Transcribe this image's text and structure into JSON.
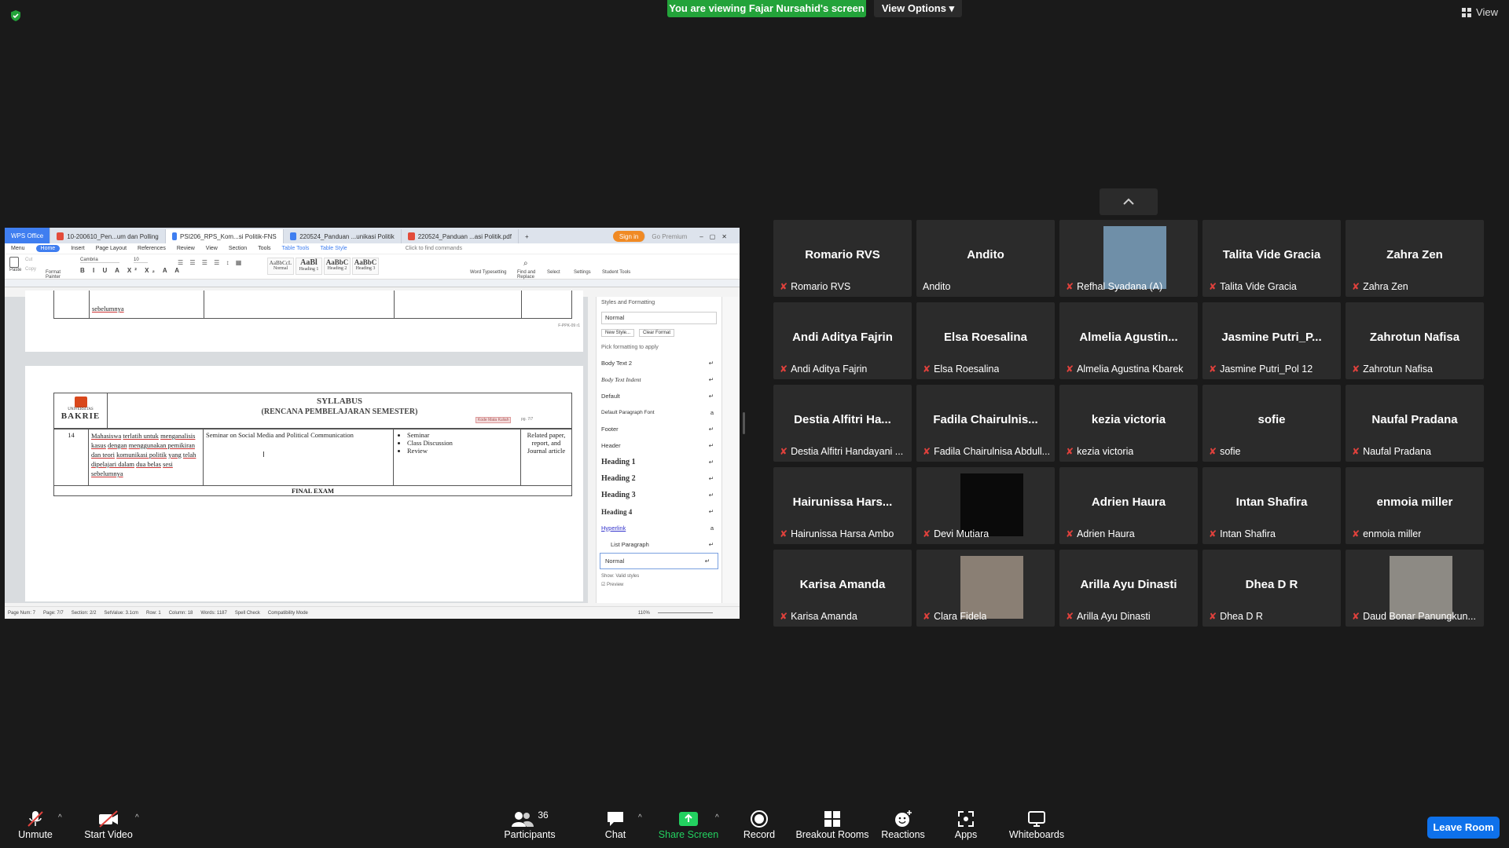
{
  "banner": {
    "viewing": "You are viewing Fajar Nursahid's screen",
    "view_options": "View Options",
    "view": "View"
  },
  "shared": {
    "tabs": [
      "WPS Office",
      "10-200610_Pen...um dan Polling",
      "PSI206_RPS_Kom...si Politik-FNS",
      "220524_Panduan ...unikasi Politik",
      "220524_Panduan ...asi Politik.pdf"
    ],
    "sign_in": "Sign in",
    "go_premium": "Go Premium",
    "menu": [
      "Menu",
      "Home",
      "Insert",
      "Page Layout",
      "References",
      "Review",
      "View",
      "Section",
      "Tools",
      "Table Tools",
      "Table Style"
    ],
    "search": "Click to find commands",
    "ribbon": {
      "paste": "Paste",
      "cut": "Cut",
      "copy": "Copy",
      "format_painter": "Format Painter",
      "font": "Cambria",
      "size": "10",
      "styles": [
        "Normal",
        "Heading 1",
        "Heading 2",
        "Heading 3"
      ],
      "style_previews": [
        "AaBbCcL",
        "AaBl",
        "AaBbC",
        "AaBbC"
      ],
      "word_typesetting": "Word Typesetting",
      "find_replace": "Find and Replace",
      "select": "Select",
      "settings": "Settings",
      "student_tools": "Student Tools"
    },
    "doc": {
      "prev_text": "sebelumnya",
      "footer_code": "F-PPK-09 r1",
      "logo_top": "UNIVERSITAS",
      "logo_name": "BAKRIE",
      "title": "SYLLABUS",
      "subtitle": "(RENCANA PEMBELAJARAN SEMESTER)",
      "kode": "Kode Mata Kuliah",
      "pg": "pg. 7/7",
      "week": "14",
      "competency": [
        "Mahasiswa",
        "terlatih untuk",
        "menganalisis kasus",
        "dengan",
        "menggunakan pemikiran",
        "dan teori",
        "komunikasi politik",
        "yang",
        "telah",
        "dipelajari dalam",
        "dua belas",
        "sesi",
        "sebelumnya"
      ],
      "topic": "Seminar on Social Media and Political Communication",
      "methods": [
        "Seminar",
        "Class Discussion",
        "Review"
      ],
      "assessment": "Related paper, report, and Journal article",
      "final": "FINAL EXAM"
    },
    "pane": {
      "title": "Styles and Formatting",
      "current": "Normal",
      "new_style": "New Style...",
      "clear": "Clear Format",
      "pick": "Pick formatting to apply",
      "styles": [
        "Body Text 2",
        "Body Text Indent",
        "Default",
        "Default Paragraph Font",
        "Footer",
        "Header",
        "Heading 1",
        "Heading 2",
        "Heading 3",
        "Heading 4",
        "Hyperlink",
        "List Paragraph",
        "Normal"
      ],
      "show": "Show:",
      "show_val": "Valid styles",
      "preview": "Preview"
    },
    "status": {
      "page_num": "Page Num: 7",
      "page": "Page: 7/7",
      "section": "Section: 2/2",
      "setvalue": "SetValue: 3.1cm",
      "row": "Row: 1",
      "column": "Column: 18",
      "words": "Words: 1187",
      "spell": "Spell Check",
      "compat": "Compatibility Mode",
      "zoom": "110%"
    }
  },
  "participants": [
    {
      "big": "Romario RVS",
      "name": "Romario RVS",
      "muted": true,
      "video": false
    },
    {
      "big": "Andito",
      "name": "Andito",
      "muted": false,
      "video": false
    },
    {
      "big": "",
      "name": "Refhal Syadana (A)",
      "muted": true,
      "video": true
    },
    {
      "big": "Talita Vide Gracia",
      "name": "Talita Vide Gracia",
      "muted": true,
      "video": false
    },
    {
      "big": "Zahra Zen",
      "name": "Zahra Zen",
      "muted": true,
      "video": false
    },
    {
      "big": "Andi Aditya Fajrin",
      "name": "Andi Aditya Fajrin",
      "muted": true,
      "video": false
    },
    {
      "big": "Elsa Roesalina",
      "name": "Elsa Roesalina",
      "muted": true,
      "video": false
    },
    {
      "big": "Almelia  Agustin...",
      "name": "Almelia Agustina Kbarek",
      "muted": true,
      "video": false
    },
    {
      "big": "Jasmine  Putri_P...",
      "name": "Jasmine Putri_Pol 12",
      "muted": true,
      "video": false
    },
    {
      "big": "Zahrotun Nafisa",
      "name": "Zahrotun Nafisa",
      "muted": true,
      "video": false
    },
    {
      "big": "Destia  Alfitri  Ha...",
      "name": "Destia Alfitri Handayani ...",
      "muted": true,
      "video": false
    },
    {
      "big": "Fadila  Chairulnis...",
      "name": "Fadila Chairulnisa Abdull...",
      "muted": true,
      "video": false
    },
    {
      "big": "kezia victoria",
      "name": "kezia victoria",
      "muted": true,
      "video": false
    },
    {
      "big": "sofie",
      "name": "sofie",
      "muted": true,
      "video": false
    },
    {
      "big": "Naufal Pradana",
      "name": "Naufal Pradana",
      "muted": true,
      "video": false
    },
    {
      "big": "Hairunissa  Hars...",
      "name": "Hairunissa Harsa Ambo",
      "muted": true,
      "video": false
    },
    {
      "big": "",
      "name": "Devi Mutiara",
      "muted": true,
      "video": true
    },
    {
      "big": "Adrien Haura",
      "name": "Adrien Haura",
      "muted": true,
      "video": false
    },
    {
      "big": "Intan Shafira",
      "name": "Intan Shafira",
      "muted": true,
      "video": false
    },
    {
      "big": "enmoia miller",
      "name": "enmoia miller",
      "muted": true,
      "video": false
    },
    {
      "big": "Karisa Amanda",
      "name": "Karisa Amanda",
      "muted": true,
      "video": false
    },
    {
      "big": "",
      "name": "Clara Fidela",
      "muted": true,
      "video": true
    },
    {
      "big": "Arilla Ayu Dinasti",
      "name": "Arilla Ayu Dinasti",
      "muted": true,
      "video": false
    },
    {
      "big": "Dhea D R",
      "name": "Dhea D R",
      "muted": true,
      "video": false
    },
    {
      "big": "",
      "name": "Daud Bonar Panungkun...",
      "muted": true,
      "video": true
    }
  ],
  "toolbar": {
    "unmute": "Unmute",
    "start_video": "Start Video",
    "participants": "Participants",
    "participants_count": "36",
    "chat": "Chat",
    "share_screen": "Share Screen",
    "record": "Record",
    "breakout": "Breakout Rooms",
    "reactions": "Reactions",
    "apps": "Apps",
    "whiteboards": "Whiteboards",
    "leave": "Leave Room"
  },
  "colors": {
    "banner": "#23a33a",
    "leave": "#0e71eb",
    "tile": "#2b2b2b",
    "muted": "#e0413c",
    "wps": "#3f7ef0"
  }
}
